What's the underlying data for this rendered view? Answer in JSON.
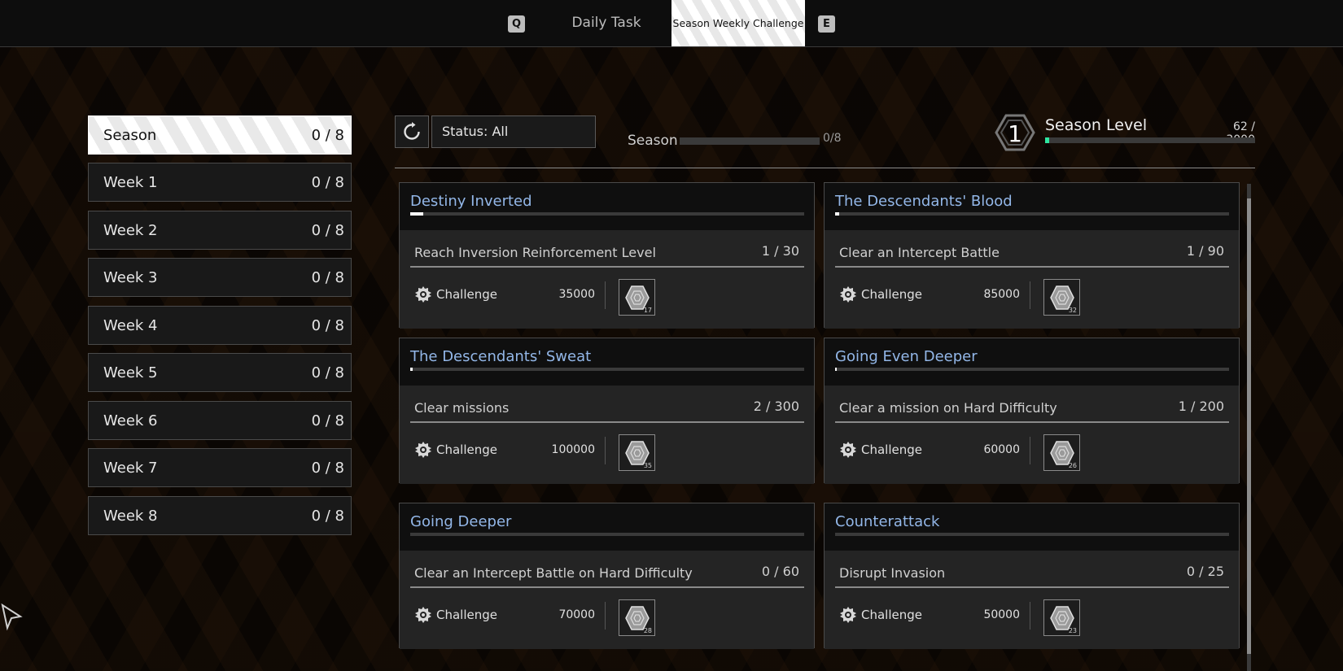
{
  "tabs": {
    "prev_key": "Q",
    "next_key": "E",
    "daily": "Daily Task",
    "season_weekly": "Season Weekly Challenge"
  },
  "sidebar": {
    "items": [
      {
        "label": "Season",
        "count": "0 / 8"
      },
      {
        "label": "Week 1",
        "count": "0 / 8"
      },
      {
        "label": "Week 2",
        "count": "0 / 8"
      },
      {
        "label": "Week 3",
        "count": "0 / 8"
      },
      {
        "label": "Week 4",
        "count": "0 / 8"
      },
      {
        "label": "Week 5",
        "count": "0 / 8"
      },
      {
        "label": "Week 6",
        "count": "0 / 8"
      },
      {
        "label": "Week 7",
        "count": "0 / 8"
      },
      {
        "label": "Week 8",
        "count": "0 / 8"
      }
    ]
  },
  "toolbar": {
    "status_filter": "Status: All",
    "season_label": "Season",
    "season_count": "0/8"
  },
  "season_level": {
    "level": "1",
    "title": "Season Level",
    "count": "62 / 3000",
    "progress": 0.0207,
    "accent_color": "#2ee6a0"
  },
  "cards": [
    {
      "title": "Destiny Inverted",
      "progress": 0.033,
      "objective": "Reach Inversion Reinforcement Level",
      "count": "1 / 30",
      "reward_label": "Challenge",
      "reward_amount": "35000",
      "item_qty": "17"
    },
    {
      "title": "The Descendants' Blood",
      "progress": 0.011,
      "objective": "Clear an Intercept Battle",
      "count": "1 / 90",
      "reward_label": "Challenge",
      "reward_amount": "85000",
      "item_qty": "32"
    },
    {
      "title": "The Descendants' Sweat",
      "progress": 0.0067,
      "objective": "Clear missions",
      "count": "2 / 300",
      "reward_label": "Challenge",
      "reward_amount": "100000",
      "item_qty": "35"
    },
    {
      "title": "Going Even Deeper",
      "progress": 0.005,
      "objective": "Clear a mission on Hard Difficulty",
      "count": "1 / 200",
      "reward_label": "Challenge",
      "reward_amount": "60000",
      "item_qty": "26"
    },
    {
      "title": "Going Deeper",
      "progress": 0,
      "objective": "Clear an Intercept Battle on Hard Difficulty",
      "count": "0 / 60",
      "reward_label": "Challenge",
      "reward_amount": "70000",
      "item_qty": "28"
    },
    {
      "title": "Counterattack",
      "progress": 0,
      "objective": "Disrupt Invasion",
      "count": "0 / 25",
      "reward_label": "Challenge",
      "reward_amount": "50000",
      "item_qty": "23"
    }
  ],
  "icons": {
    "refresh": "refresh-icon",
    "level_badge": "hexagon-level-icon",
    "reward_gear": "gear-icon",
    "reward_item": "hexagon-item-icon",
    "cursor": "cursor-icon"
  }
}
